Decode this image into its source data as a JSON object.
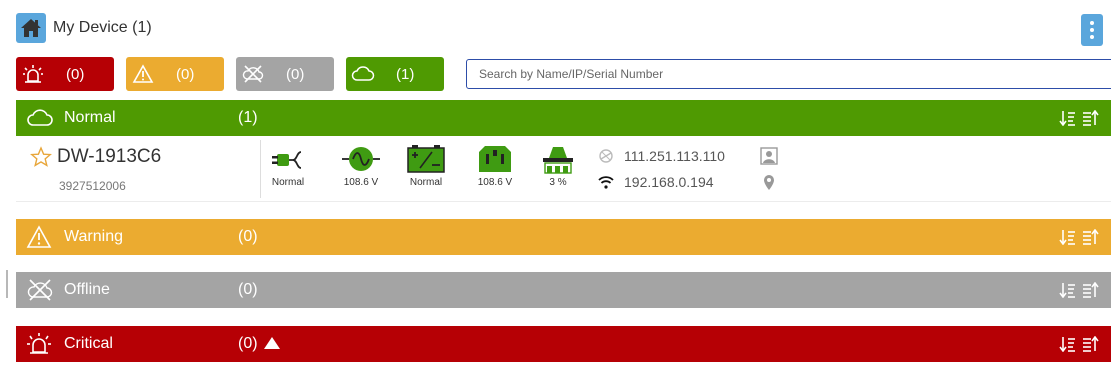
{
  "header": {
    "title": "My Device (1)"
  },
  "filters": [
    {
      "key": "critical",
      "count": "(0)",
      "icon": "alarm-icon",
      "color": "#b60005"
    },
    {
      "key": "warning",
      "count": "(0)",
      "icon": "warning-icon",
      "color": "#ebab30"
    },
    {
      "key": "offline",
      "count": "(0)",
      "icon": "offline-icon",
      "color": "#a4a4a4"
    },
    {
      "key": "normal",
      "count": "(1)",
      "icon": "cloud-icon",
      "color": "#4f9a02"
    }
  ],
  "search": {
    "placeholder": "Search by Name/IP/Serial Number",
    "value": ""
  },
  "groups": {
    "normal": {
      "label": "Normal",
      "count": "(1)"
    },
    "warning": {
      "label": "Warning",
      "count": "(0)"
    },
    "offline": {
      "label": "Offline",
      "count": "(0)"
    },
    "critical": {
      "label": "Critical",
      "count": "(0)"
    }
  },
  "device": {
    "name": "DW-1913C6",
    "serial": "3927512006",
    "stats": [
      {
        "icon": "plug-icon",
        "label": "Normal"
      },
      {
        "icon": "ac-wave-icon",
        "label": "108.6 V"
      },
      {
        "icon": "battery-icon",
        "label": "Normal"
      },
      {
        "icon": "outlet-icon",
        "label": "108.6 V"
      },
      {
        "icon": "load-icon",
        "label": "3 %"
      }
    ],
    "external_ip": "111.251.113.110",
    "local_ip": "192.168.0.194"
  }
}
